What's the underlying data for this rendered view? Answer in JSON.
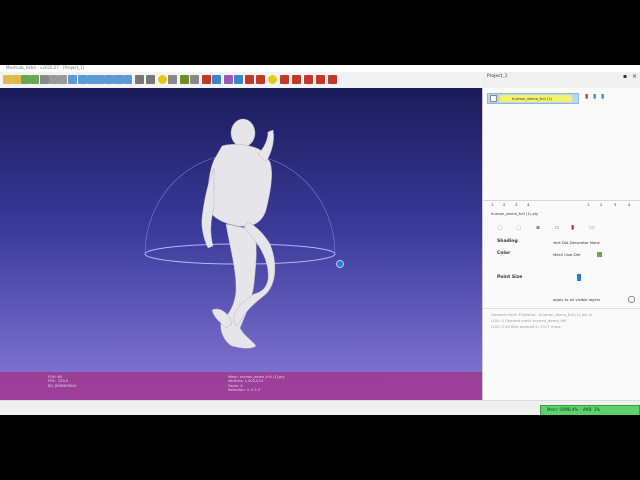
{
  "app": {
    "title": "MeshLab_64bit - v2020.07 - [Project_1]",
    "accent": "#3a3a9a"
  },
  "toolbar": {
    "icons": [
      {
        "name": "open-icon",
        "color": "#e1b84a"
      },
      {
        "name": "open-project-icon",
        "color": "#e1b84a"
      },
      {
        "name": "save-icon",
        "color": "#6aa84f"
      },
      {
        "name": "reload-icon",
        "color": "#6aa84f"
      },
      {
        "name": "import-icon",
        "color": "#888888"
      },
      {
        "name": "export-icon",
        "color": "#999999"
      },
      {
        "name": "snapshot-icon",
        "color": "#999999"
      },
      {
        "name": "bbox-icon",
        "color": "#5b9bd5"
      },
      {
        "name": "points-icon",
        "color": "#5b9bd5"
      },
      {
        "name": "wireframe-icon",
        "color": "#5b9bd5"
      },
      {
        "name": "hidden-lines-icon",
        "color": "#5b9bd5"
      },
      {
        "name": "flat-lines-icon",
        "color": "#5b9bd5"
      },
      {
        "name": "flat-icon",
        "color": "#5b9bd5"
      },
      {
        "name": "smooth-icon",
        "color": "#5b9bd5"
      },
      {
        "name": "color-icon",
        "color": "#777777"
      },
      {
        "name": "light-icon",
        "color": "#777777"
      },
      {
        "name": "annotation-icon",
        "color": "#e6c619"
      },
      {
        "name": "select-faces-icon",
        "color": "#888888"
      },
      {
        "name": "brush-icon",
        "color": "#6b8e23"
      },
      {
        "name": "layers-icon",
        "color": "#888888"
      },
      {
        "name": "paint-icon",
        "color": "#c0392b"
      },
      {
        "name": "palette-icon",
        "color": "#3d85c6"
      },
      {
        "name": "align-icon",
        "color": "#9b59b6"
      },
      {
        "name": "measure-icon",
        "color": "#3d85c6"
      },
      {
        "name": "pick-icon",
        "color": "#c0392b"
      },
      {
        "name": "mark-icon",
        "color": "#c0392b"
      },
      {
        "name": "info-icon",
        "color": "#e6c619"
      },
      {
        "name": "paint-brush-icon",
        "color": "#c0392b"
      },
      {
        "name": "cut-icon",
        "color": "#c0392b"
      },
      {
        "name": "edit-icon",
        "color": "#c0392b"
      },
      {
        "name": "delete-vertices-icon",
        "color": "#c0392b"
      },
      {
        "name": "delete-faces-icon",
        "color": "#c0392b"
      }
    ]
  },
  "viewport": {
    "info_left": "FOV: 60\nFPS:  250.0\nBO_RENDERING",
    "info_center": "Mesh: human_demo_full (1).ply\nVertices: 1,002,074\nFaces: 0\nSelection: v: 0 f: 0"
  },
  "panel": {
    "title": "Project_1",
    "layer_name": "human_demo_full (1)",
    "tabs_left": [
      "1",
      "2",
      "3",
      "4"
    ],
    "tabs_right": [
      "1",
      "2",
      "3",
      "4"
    ],
    "file_name": "human_demo_full (1).ply",
    "shading_label": "Shading",
    "shading_options": "Vert   Dot Decorator  None",
    "color_label": "Color",
    "color_options": "Mesh  User-Def",
    "point_size_label": "Point Size",
    "apply_label": "apply to all visible layers",
    "log_lines": [
      "Opened mesh F:/demo/.../human_demo_full (1).ply in",
      "LOG: 0 Opened mesh human_demo_full",
      "LOG: 0 All files opened in 1317 msec"
    ]
  },
  "statusbar": {
    "memory_text": "Mem: 59MB 4% - VMB: 3%"
  }
}
